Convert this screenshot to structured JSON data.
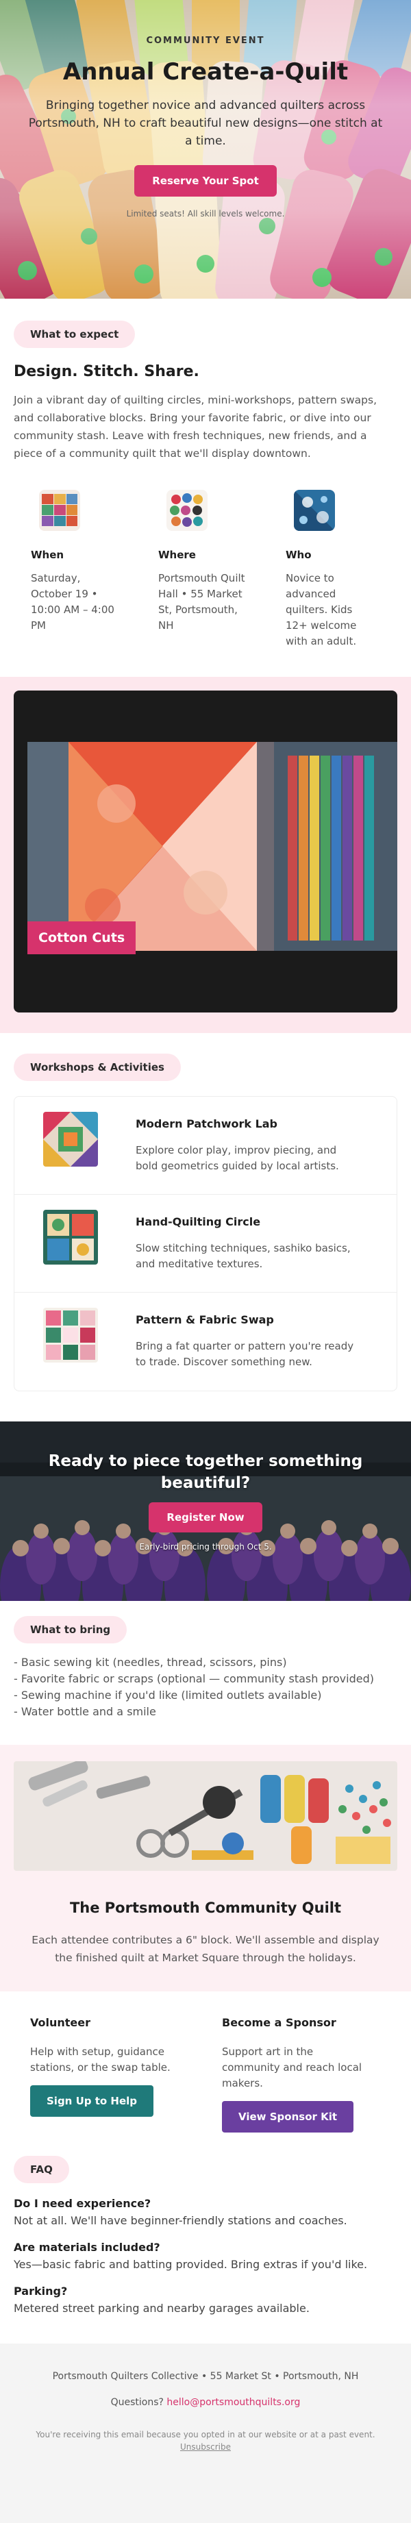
{
  "hero": {
    "eyebrow": "COMMUNITY EVENT",
    "title": "Annual Create-a-Quilt",
    "subtitle": "Bringing together novice and advanced quilters across Portsmouth, NH to craft beautiful new designs—one stitch at a time.",
    "cta_label": "Reserve Your Spot",
    "note": "Limited seats! All skill levels welcome."
  },
  "expect": {
    "pill": "What to expect",
    "heading": "Design. Stitch. Share.",
    "body": "Join a vibrant day of quilting circles, mini-workshops, pattern swaps, and collaborative blocks. Bring your favorite fabric, or dive into our community stash. Leave with fresh techniques, new friends, and a piece of a community quilt that we'll display downtown.",
    "info": [
      {
        "label": "When",
        "text": "Saturday, October 19 • 10:00 AM – 4:00 PM"
      },
      {
        "label": "Where",
        "text": "Portsmouth Quilt Hall • 55 Market St, Portsmouth, NH"
      },
      {
        "label": "Who",
        "text": "Novice to advanced quilters. Kids 12+ welcome with an adult."
      }
    ]
  },
  "video": {
    "tag": "Cotton Cuts"
  },
  "workshops": {
    "pill": "Workshops & Activities",
    "items": [
      {
        "title": "Modern Patchwork Lab",
        "desc": "Explore color play, improv piecing, and bold geometrics guided by local artists."
      },
      {
        "title": "Hand-Quilting Circle",
        "desc": "Slow stitching techniques, sashiko basics, and meditative textures."
      },
      {
        "title": "Pattern & Fabric Swap",
        "desc": "Bring a fat quarter or pattern you're ready to trade. Discover something new."
      }
    ]
  },
  "cta": {
    "title": "Ready to piece together something beautiful?",
    "button": "Register Now",
    "note": "Early-bird pricing through Oct 5."
  },
  "bring": {
    "pill": "What to bring",
    "items": [
      "- Basic sewing kit (needles, thread, scissors, pins)",
      "- Favorite fabric or scraps (optional — community stash provided)",
      "- Sewing machine if you'd like (limited outlets available)",
      "- Water bottle and a smile"
    ]
  },
  "quilt": {
    "title": "The Portsmouth Community Quilt",
    "text": "Each attendee contributes a 6\" block. We'll assemble and display the finished quilt at Market Square through the holidays."
  },
  "volunteer": {
    "title": "Volunteer",
    "text": "Help with setup, guidance stations, or the swap table.",
    "button": "Sign Up to Help"
  },
  "sponsor": {
    "title": "Become a Sponsor",
    "text": "Support art in the community and reach local makers.",
    "button": "View Sponsor Kit"
  },
  "faq": {
    "pill": "FAQ",
    "items": [
      {
        "q": "Do I need experience?",
        "a": "Not at all. We'll have beginner-friendly stations and coaches."
      },
      {
        "q": "Are materials included?",
        "a": "Yes—basic fabric and batting provided. Bring extras if you'd like."
      },
      {
        "q": "Parking?",
        "a": "Metered street parking and nearby garages available."
      }
    ]
  },
  "footer": {
    "address": "Portsmouth Quilters Collective • 55 Market St • Portsmouth, NH",
    "questions_prefix": "Questions?",
    "email": "hello@portsmouthquilts.org",
    "note": "You're receiving this email because you opted in at our website or at a past event.",
    "unsubscribe": "Unsubscribe"
  },
  "colors": {
    "accent": "#d6336c",
    "pill_bg": "#fde7ed",
    "teal": "#1f7a7a",
    "purple": "#6a3fa0"
  }
}
